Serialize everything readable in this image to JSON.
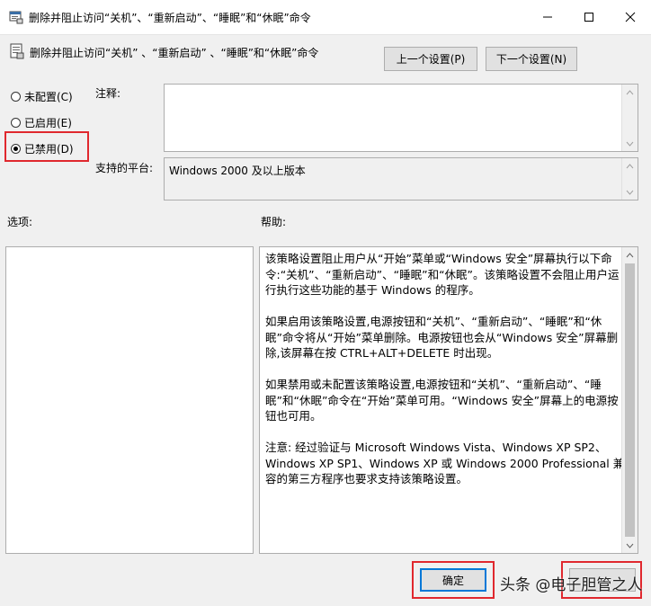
{
  "window": {
    "title": "删除并阻止访问“关机”、“重新启动”、“睡眠”和“休眠”命令",
    "minimize_icon": "minimize-icon",
    "maximize_icon": "maximize-icon",
    "close_icon": "close-icon"
  },
  "header": {
    "policy_name": "删除并阻止访问“关机” 、“重新启动” 、“睡眠”和“休眠”命令",
    "prev_button": "上一个设置(P)",
    "next_button": "下一个设置(N)"
  },
  "state": {
    "options": [
      {
        "label": "未配置(C)",
        "checked": false
      },
      {
        "label": "已启用(E)",
        "checked": false
      },
      {
        "label": "已禁用(D)",
        "checked": true
      }
    ]
  },
  "comment": {
    "label": "注释:",
    "value": ""
  },
  "platform": {
    "label": "支持的平台:",
    "value": "Windows 2000 及以上版本"
  },
  "options_section": {
    "label": "选项:"
  },
  "help": {
    "label": "帮助:",
    "paragraphs": [
      "该策略设置阻止用户从“开始”菜单或“Windows 安全”屏幕执行以下命令:“关机”、“重新启动”、“睡眠”和“休眠”。该策略设置不会阻止用户运行执行这些功能的基于 Windows 的程序。",
      "如果启用该策略设置,电源按钮和“关机”、“重新启动”、“睡眠”和“休眠”命令将从“开始”菜单删除。电源按钮也会从“Windows 安全”屏幕删除,该屏幕在按 CTRL+ALT+DELETE 时出现。",
      "如果禁用或未配置该策略设置,电源按钮和“关机”、“重新启动”、“睡眠”和“休眠”命令在“开始”菜单可用。“Windows 安全”屏幕上的电源按钮也可用。",
      "注意: 经过验证与 Microsoft Windows Vista、Windows XP SP2、Windows XP SP1、Windows XP 或 Windows 2000 Professional 兼容的第三方程序也要求支持该策略设置。"
    ]
  },
  "footer": {
    "ok_button": "确定"
  },
  "watermark": "头条 @电子胆管之人"
}
